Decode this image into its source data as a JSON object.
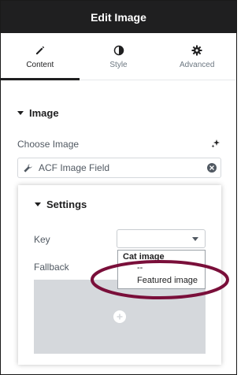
{
  "header": {
    "title": "Edit Image"
  },
  "tabs": [
    {
      "label": "Content",
      "icon": "pencil-icon",
      "active": true
    },
    {
      "label": "Style",
      "icon": "half-circle-icon",
      "active": false
    },
    {
      "label": "Advanced",
      "icon": "gear-icon",
      "active": false
    }
  ],
  "image_section": {
    "title": "Image",
    "choose_label": "Choose Image",
    "field_value": "ACF Image Field"
  },
  "settings": {
    "title": "Settings",
    "key_label": "Key",
    "fallback_label": "Fallback"
  },
  "dropdown": {
    "group_label": "Cat image",
    "options": [
      "--",
      "Featured image"
    ]
  },
  "colors": {
    "header_bg": "#1f1f20",
    "highlight": "#7a0f3a",
    "placeholder_bg": "#d5d8dc"
  }
}
